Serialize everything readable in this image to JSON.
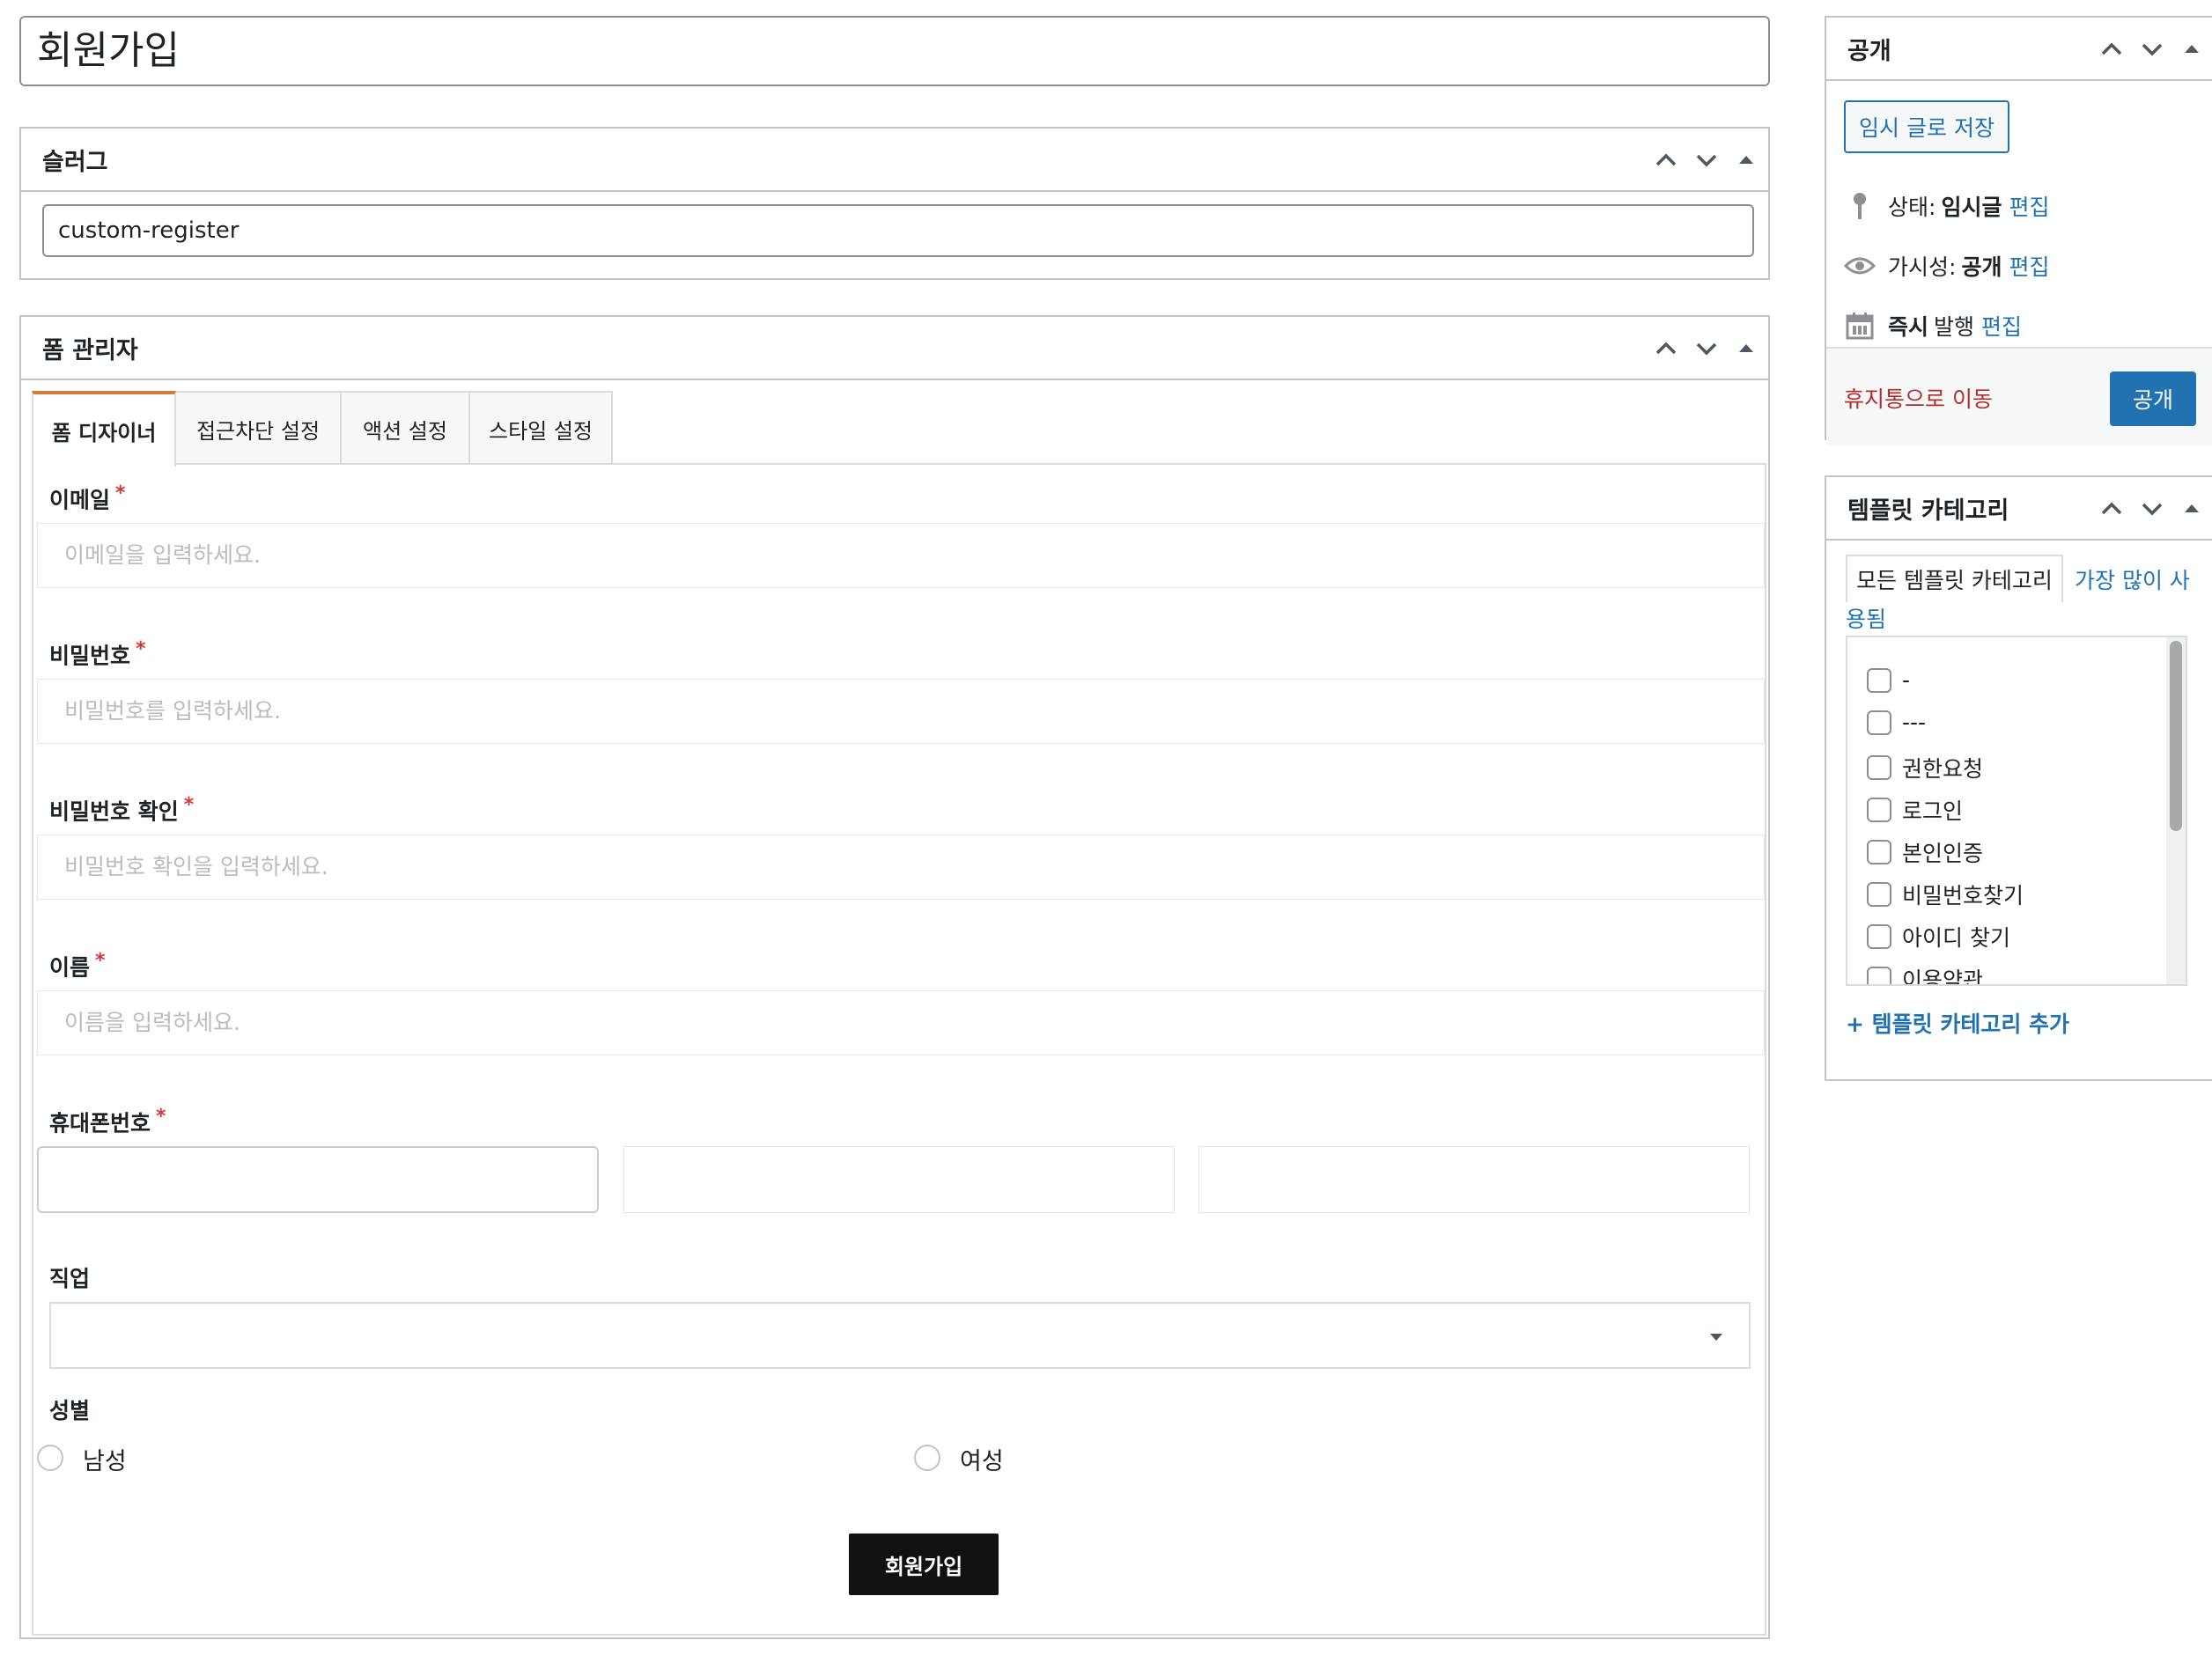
{
  "title": "회원가입",
  "slug_box": {
    "title": "슬러그",
    "value": "custom-register"
  },
  "form_manager": {
    "title": "폼 관리자",
    "tabs": [
      "폼 디자이너",
      "접근차단 설정",
      "액션 설정",
      "스타일 설정"
    ],
    "required_mark": "*",
    "fields": {
      "email": {
        "label": "이메일",
        "placeholder": "이메일을 입력하세요."
      },
      "password": {
        "label": "비밀번호",
        "placeholder": "비밀번호를 입력하세요."
      },
      "password_confirm": {
        "label": "비밀번호 확인",
        "placeholder": "비밀번호 확인을 입력하세요."
      },
      "name": {
        "label": "이름",
        "placeholder": "이름을 입력하세요."
      },
      "phone": {
        "label": "휴대폰번호"
      },
      "job": {
        "label": "직업",
        "selected": ""
      },
      "gender": {
        "label": "성별",
        "options": [
          "남성",
          "여성"
        ]
      }
    },
    "submit_label": "회원가입"
  },
  "publish_box": {
    "title": "공개",
    "save_draft": "임시 글로 저장",
    "status": {
      "label": "상태:",
      "value": "임시글",
      "edit": "편집"
    },
    "visibility": {
      "label": "가시성:",
      "value": "공개",
      "edit": "편집"
    },
    "schedule": {
      "label": "즉시",
      "value": "발행",
      "edit": "편집"
    },
    "trash": "휴지통으로 이동",
    "publish": "공개"
  },
  "template_category_box": {
    "title": "템플릿 카테고리",
    "tab_all": "모든 템플릿 카테고리",
    "tab_popular": "가장 많이 사용됨",
    "items": [
      "-",
      "---",
      "권한요청",
      "로그인",
      "본인인증",
      "비밀번호찾기",
      "아이디 찾기",
      "이용약관"
    ],
    "add_link": "+ 템플릿 카테고리 추가"
  },
  "colors": {
    "accent_blue": "#2271b1",
    "tab_active_border": "#d67b36",
    "required_red": "#d63638",
    "trash_red": "#b32d2e"
  }
}
